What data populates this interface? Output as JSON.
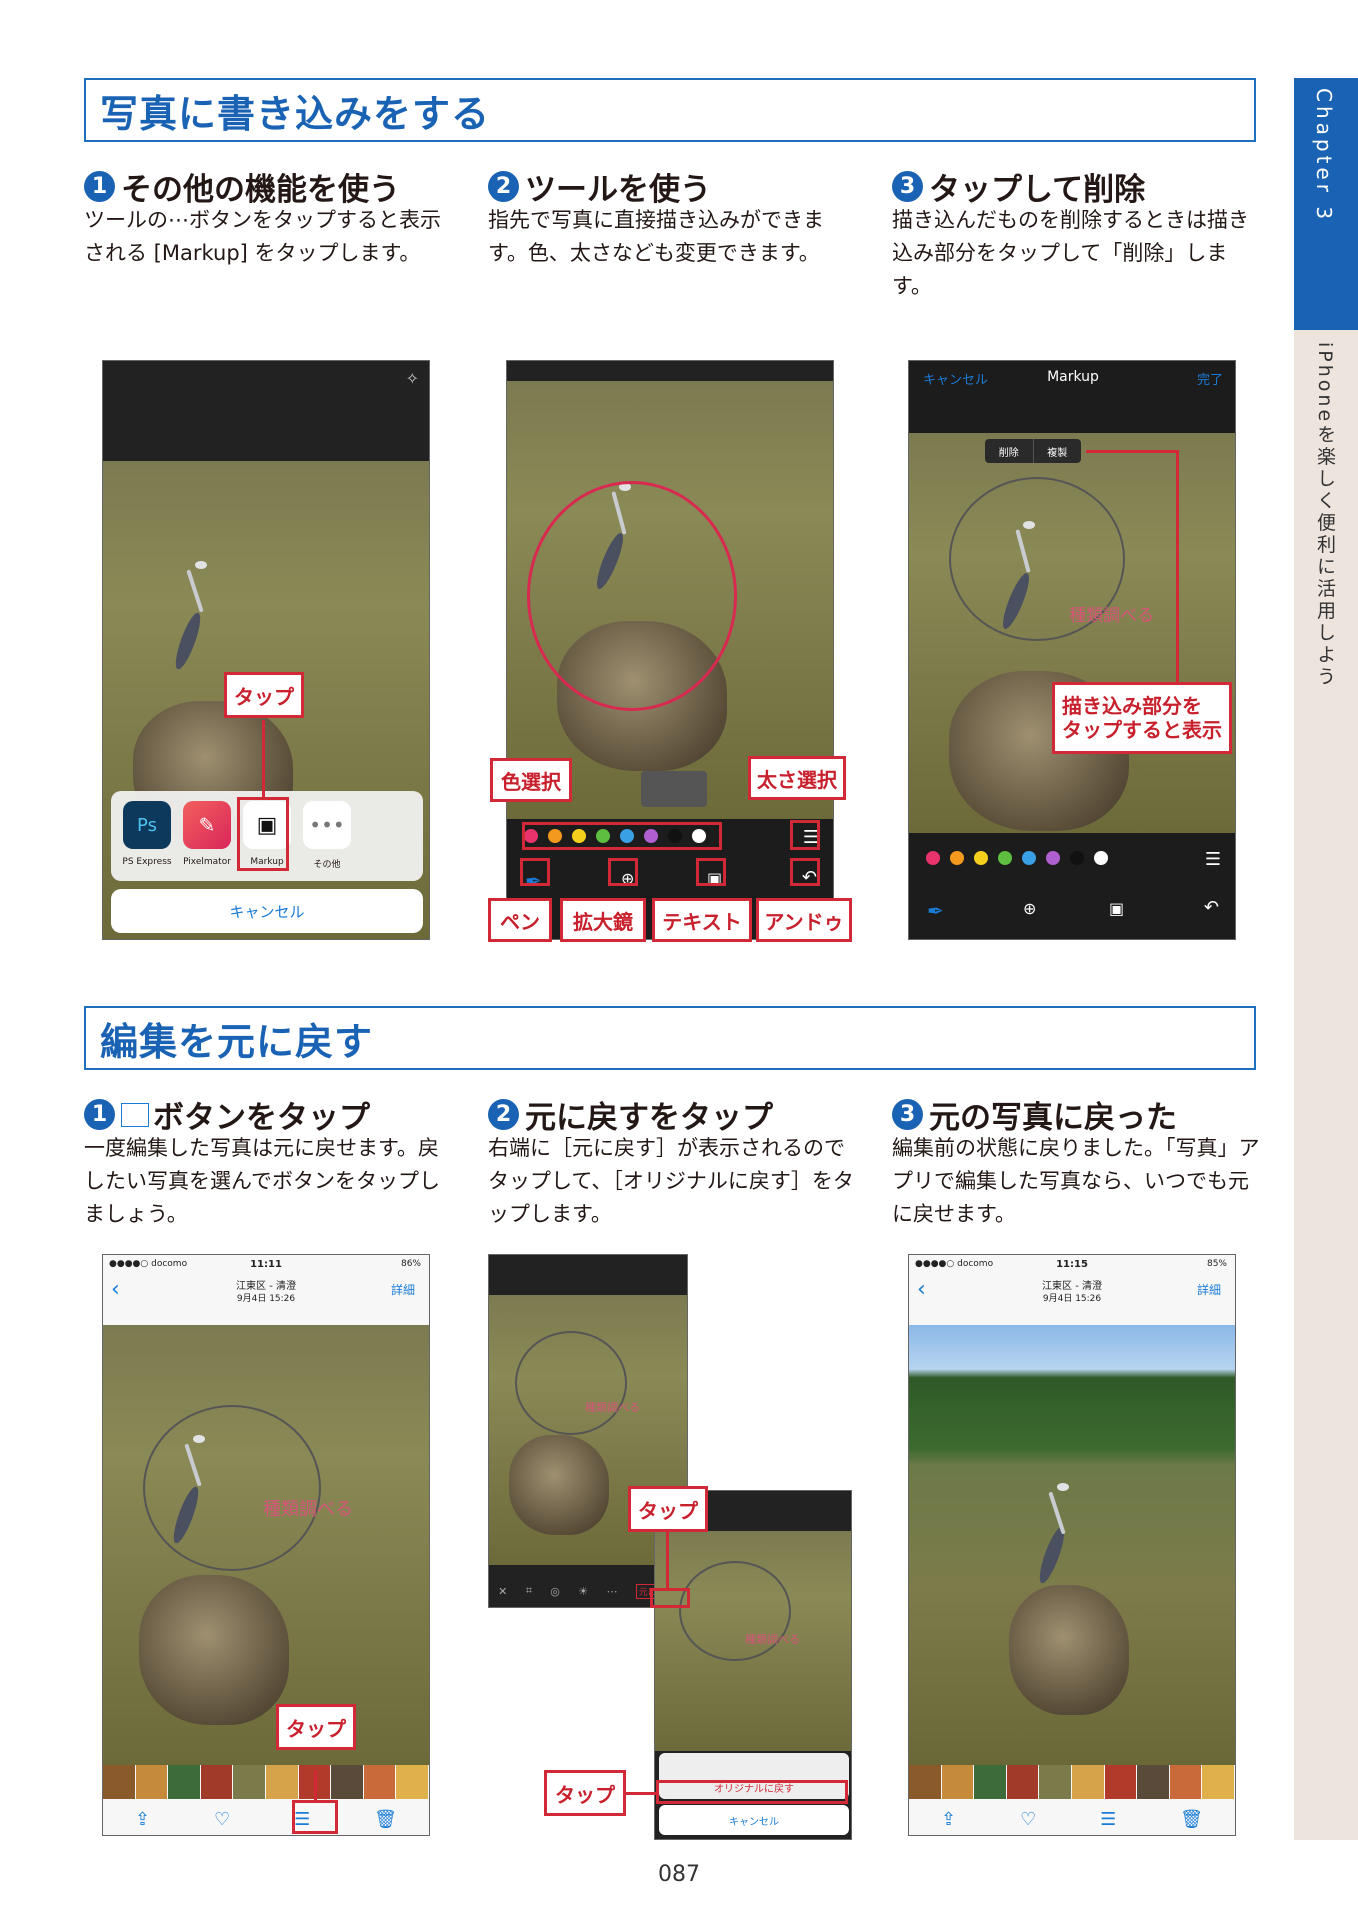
{
  "section1": {
    "title": "写真に書き込みをする",
    "steps": [
      {
        "num": "1",
        "heading": "その他の機能を使う",
        "body": "ツールの⋯ボタンをタップすると表示される [Markup] をタップします。"
      },
      {
        "num": "2",
        "heading": "ツールを使う",
        "body": "指先で写真に直接描き込みができます。色、太さなども変更できます。"
      },
      {
        "num": "3",
        "heading": "タップして削除",
        "body": "描き込んだものを削除するときは描き込み部分をタップして「削除」します。"
      }
    ]
  },
  "shot1": {
    "apps": [
      "PS Express",
      "Pixelmator",
      "Markup",
      "その他"
    ],
    "cancel": "キャンセル",
    "tap": "タップ"
  },
  "shot2": {
    "callouts": {
      "color": "色選択",
      "width": "太さ選択",
      "pen": "ペン",
      "magnifier": "拡大鏡",
      "text": "テキスト",
      "undo": "アンドゥ"
    },
    "colors": [
      "#e8336d",
      "#f39a1e",
      "#f4d01c",
      "#5dbe3f",
      "#3aa0e5",
      "#b05fd0",
      "#111111",
      "#ffffff"
    ]
  },
  "shot3": {
    "cancel": "キャンセル",
    "title": "Markup",
    "done": "完了",
    "delete": "削除",
    "duplicate": "複製",
    "annotation": "種類調べる",
    "callout": "描き込み部分を\nタップすると表示"
  },
  "section2": {
    "title": "編集を元に戻す",
    "steps": [
      {
        "num": "1",
        "heading": "ボタンをタップ",
        "body": "一度編集した写真は元に戻せます。戻したい写真を選んでボタンをタップしましょう。"
      },
      {
        "num": "2",
        "heading": "元に戻すをタップ",
        "body": "右端に［元に戻す］が表示されるのでタップして、［オリジナルに戻す］をタップします。"
      },
      {
        "num": "3",
        "heading": "元の写真に戻った",
        "body": "編集前の状態に戻りました。「写真」アプリで編集した写真なら、いつでも元に戻せます。"
      }
    ]
  },
  "shot4": {
    "carrier": "●●●●○ docomo",
    "time": "11:11",
    "battery": "86%",
    "place": "江東区 - 清澄",
    "date": "9月4日 15:26",
    "detail": "詳細",
    "annotation": "種類調べる",
    "tap": "タップ"
  },
  "shot5": {
    "tap1": "タップ",
    "tap2": "タップ",
    "revert": "元に戻す",
    "annotation": "種類調べる",
    "original": "オリジナルに戻す",
    "cancel": "キャンセル"
  },
  "shot6": {
    "carrier": "●●●●○ docomo",
    "time": "11:15",
    "battery": "85%",
    "place": "江東区 - 清澄",
    "date": "9月4日 15:26",
    "detail": "詳細"
  },
  "sidebar": {
    "chapter": "Chapter 3",
    "subtitle": "iPhoneを楽しく便利に活用しよう"
  },
  "page_number": "087"
}
